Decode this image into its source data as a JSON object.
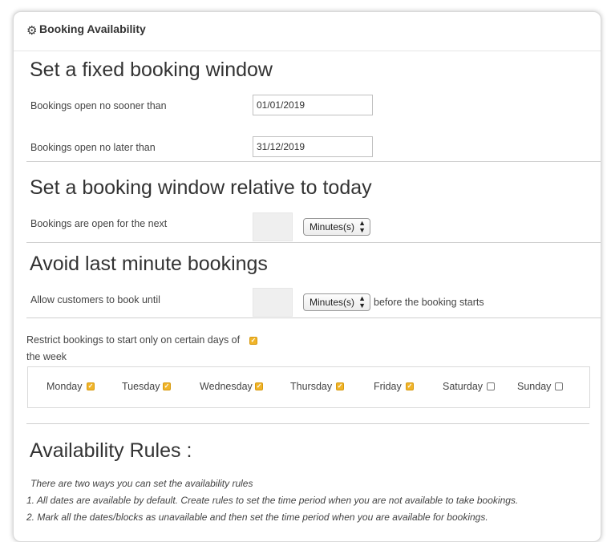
{
  "card": {
    "title": "Booking Availability",
    "icon": "gear-icon"
  },
  "fixed_window": {
    "heading": "Set a fixed booking window",
    "open_from_label": "Bookings open no sooner than",
    "open_from_value": "01/01/2019",
    "open_until_label": "Bookings open no later than",
    "open_until_value": "31/12/2019"
  },
  "relative_window": {
    "heading": "Set a booking window relative to today",
    "label": "Bookings are open for the next",
    "value": "",
    "unit": "Minutes(s)"
  },
  "last_minute": {
    "heading": "Avoid last minute bookings",
    "label": "Allow customers to book until",
    "value": "",
    "unit": "Minutes(s)",
    "suffix": "before the booking starts"
  },
  "restrict_days": {
    "label_line1": "Restrict bookings to start only on certain days of",
    "label_line2": "the week",
    "checked": true,
    "days": [
      {
        "label": "Monday",
        "checked": true
      },
      {
        "label": "Tuesday",
        "checked": true
      },
      {
        "label": "Wednesday",
        "checked": true
      },
      {
        "label": "Thursday",
        "checked": true
      },
      {
        "label": "Friday",
        "checked": true
      },
      {
        "label": "Saturday",
        "checked": false
      },
      {
        "label": "Sunday",
        "checked": false
      }
    ]
  },
  "rules": {
    "heading": "Availability Rules :",
    "intro": "There are two ways you can set the availability rules",
    "item1": "1. All dates are available by default. Create rules to set the time period when you are not available to take bookings.",
    "item2": "2. Mark all the dates/blocks as unavailable and then set the time period when you are available for bookings."
  },
  "colors": {
    "checkbox_checked": "#f0b429",
    "border": "#d9d9d9"
  }
}
